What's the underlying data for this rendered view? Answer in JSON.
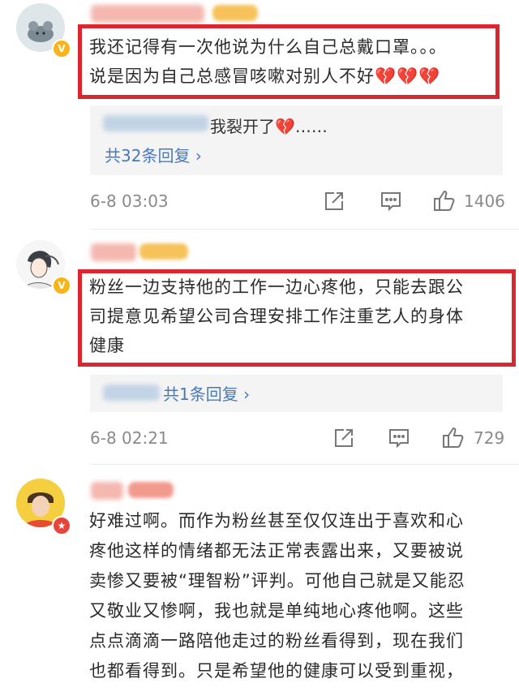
{
  "comments": [
    {
      "text_line1": "我还记得有一次他说为什么自己总戴口罩。。。",
      "text_line2": "说是因为自己总感冒咳嗽对别人不好",
      "text_hearts": "💔💔💔",
      "reply_text": "我裂开了",
      "reply_heart": "💔",
      "reply_ellipsis": "……",
      "replies_label": "共32条回复",
      "time": "6-8 03:03",
      "likes": "1406"
    },
    {
      "text_line1": "粉丝一边支持他的工作一边心疼他，只能去跟公",
      "text_line2": "司提意见希望公司合理安排工作注重艺人的身体",
      "text_line3": "健康",
      "replies_label": "共1条回复",
      "time": "6-8 02:21",
      "likes": "729"
    },
    {
      "lines": [
        "好难过啊。而作为粉丝甚至仅仅连出于喜欢和心",
        "疼他这样的情绪都无法正常表露出来，又要被说",
        "卖惨又要被“理智粉”评判。可他自己就是又能忍",
        "又敬业又惨啊，我也就是单纯地心疼他啊。这些",
        "点点滴滴一路陪他走过的粉丝看得到，现在我们",
        "也都看得到。只是希望他的健康可以受到重视，"
      ]
    }
  ],
  "icons": {
    "share": "share-icon",
    "comment": "comment-icon",
    "like": "thumbs-up-icon",
    "chevron": "chevron-right-icon"
  },
  "colors": {
    "highlight_border": "#d9262f",
    "link": "#4a7ab8",
    "meta": "#8a8a8a",
    "reply_bg": "#f4f4f4"
  }
}
